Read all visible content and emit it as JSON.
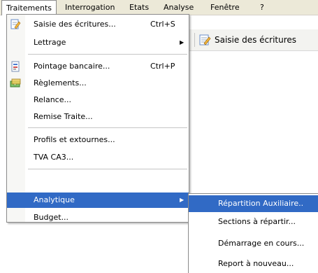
{
  "menubar": {
    "items": [
      {
        "label": "Traitements",
        "ul": "T"
      },
      {
        "label": "Interrogation",
        "ul": "I"
      },
      {
        "label": "Etats",
        "ul": "E"
      },
      {
        "label": "Analyse",
        "ul": "A"
      },
      {
        "label": "Fenêtre",
        "ul": "n"
      },
      {
        "label": "?"
      }
    ]
  },
  "toolbar": {
    "grip": "s",
    "button_label": "Saisie des écritures",
    "button_icon": "edit-document-icon"
  },
  "menu": {
    "items": [
      {
        "label": "Saisie des écritures...",
        "shortcut": "Ctrl+S",
        "icon": "edit-document-icon"
      },
      {
        "label": "Lettrage",
        "submenu": true
      },
      {
        "label": "Pointage bancaire...",
        "shortcut": "Ctrl+P",
        "icon": "bank-statement-icon"
      },
      {
        "label": "Règlements...",
        "icon": "payments-icon"
      },
      {
        "label": "Relance..."
      },
      {
        "label": "Remise Traite..."
      },
      {
        "label": "Profils et extournes..."
      },
      {
        "label": "TVA CA3..."
      },
      {
        "label": "Analytique",
        "submenu": true,
        "highlighted": true
      },
      {
        "label": "Budget..."
      }
    ]
  },
  "submenu": {
    "items": [
      {
        "label": "Répartition Auxiliaire..",
        "highlighted": true
      },
      {
        "label": "Sections à répartir..."
      },
      {
        "label": "Démarrage en cours..."
      },
      {
        "label": "Report à nouveau..."
      }
    ]
  },
  "colors": {
    "highlight": "#316ac5",
    "menubar": "#ece9d8",
    "gutter": "#f7f7f5"
  }
}
